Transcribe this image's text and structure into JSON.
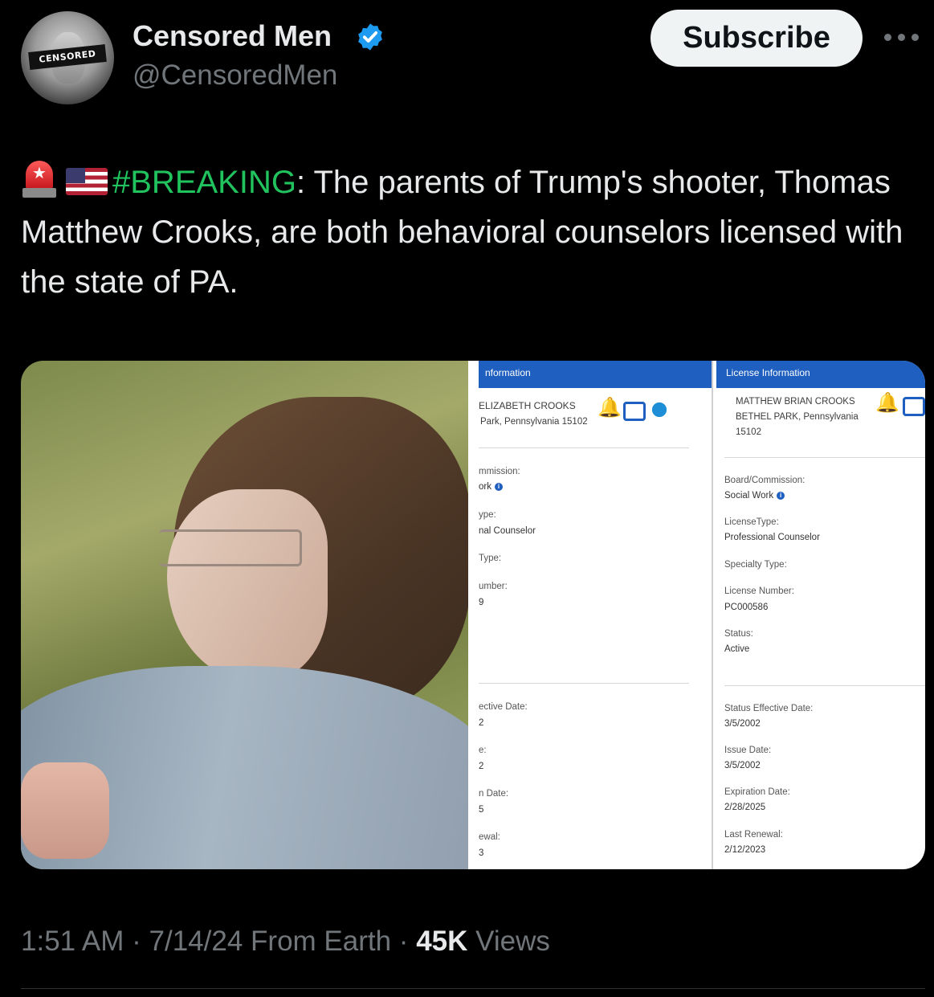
{
  "author": {
    "avatar_label": "CENSORED",
    "name": "Censored Men",
    "handle": "@CensoredMen"
  },
  "actions": {
    "subscribe_label": "Subscribe"
  },
  "tweet": {
    "hashtag": "#BREAKING",
    "text": ": The parents of Trump's shooter, Thomas Matthew Crooks, are both behavioral counselors licensed with the state of PA."
  },
  "license_a": {
    "header": "nformation",
    "name_line": "ELIZABETH CROOKS",
    "addr_line": "Park, Pennsylvania 15102",
    "board_label": "mmission:",
    "board_value": "ork",
    "type_label": "ype:",
    "type_value": "nal Counselor",
    "specialty_label": "Type:",
    "number_label": "umber:",
    "number_value": "9",
    "effective_label": "ective Date:",
    "effective_value": "2",
    "issue_label": "e:",
    "issue_value": "2",
    "expiration_label": "n Date:",
    "expiration_value": "5",
    "renewal_label": "ewal:",
    "renewal_value": "3"
  },
  "license_b": {
    "header": "License Information",
    "name_line": "MATTHEW BRIAN CROOKS",
    "addr_line": "BETHEL PARK, Pennsylvania",
    "zip_line": "15102",
    "board_label": "Board/Commission:",
    "board_value": "Social Work",
    "type_label": "LicenseType:",
    "type_value": "Professional Counselor",
    "specialty_label": "Specialty Type:",
    "number_label": "License Number:",
    "number_value": "PC000586",
    "status_label": "Status:",
    "status_value": "Active",
    "effective_label": "Status Effective Date:",
    "effective_value": "3/5/2002",
    "issue_label": "Issue Date:",
    "issue_value": "3/5/2002",
    "expiration_label": "Expiration Date:",
    "expiration_value": "2/28/2025",
    "renewal_label": "Last Renewal:",
    "renewal_value": "2/12/2023"
  },
  "meta": {
    "time": "1:51 AM",
    "sep1": " · ",
    "date": "7/14/24",
    "source": " From Earth",
    "sep2": " · ",
    "views_count": "45K",
    "views_label": " Views"
  },
  "icons": [
    "verified-badge-icon",
    "more-icon",
    "siren-icon",
    "us-flag-icon",
    "bell-icon",
    "print-icon",
    "gear-icon",
    "info-icon"
  ],
  "colors": {
    "background": "#000000",
    "hashtag": "#20c35d",
    "verified": "#1d9bf0",
    "muted": "#71767b",
    "license_header": "#1f5fbf"
  }
}
